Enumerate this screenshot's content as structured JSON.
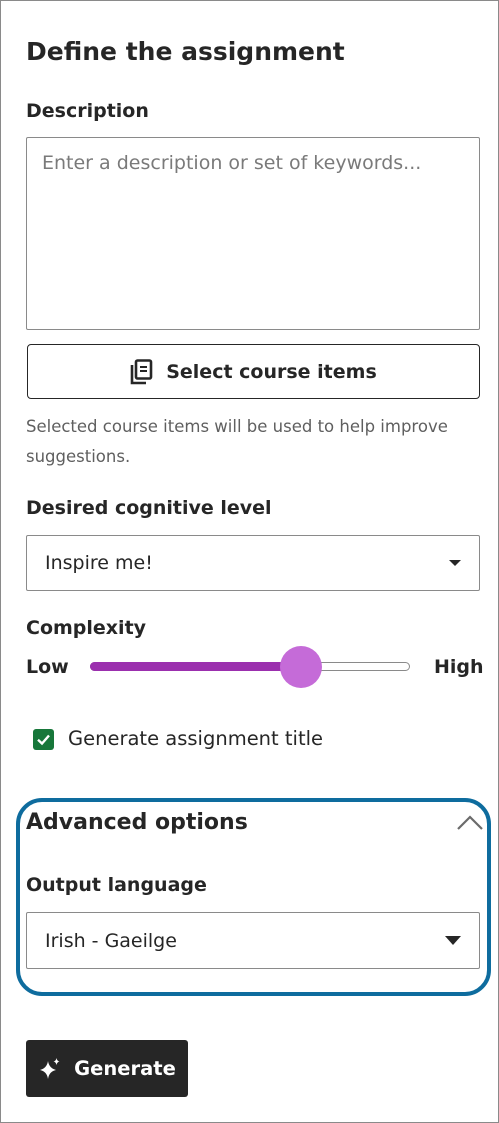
{
  "panel": {
    "title": "Define the assignment",
    "description": {
      "label": "Description",
      "placeholder": "Enter a description or set of keywords...",
      "value": ""
    },
    "select_course_items": {
      "label": "Select course items",
      "icon": "documents-icon",
      "help": "Selected course items will be used to help improve suggestions."
    },
    "cognitive_level": {
      "label": "Desired cognitive level",
      "selected": "Inspire me!"
    },
    "complexity": {
      "label": "Complexity",
      "min_label": "Low",
      "max_label": "High",
      "value_fraction": 0.66,
      "fill_color": "#9b2fae",
      "thumb_color": "#c56bd8"
    },
    "generate_title": {
      "label": "Generate assignment title",
      "checked": true,
      "color": "#17773a"
    },
    "advanced": {
      "title": "Advanced options",
      "expanded": true,
      "highlight_color": "#0e6c9e",
      "output_language": {
        "label": "Output language",
        "selected": "Irish - Gaeilge"
      }
    },
    "generate_button": {
      "label": "Generate",
      "icon": "sparkle-icon"
    }
  }
}
